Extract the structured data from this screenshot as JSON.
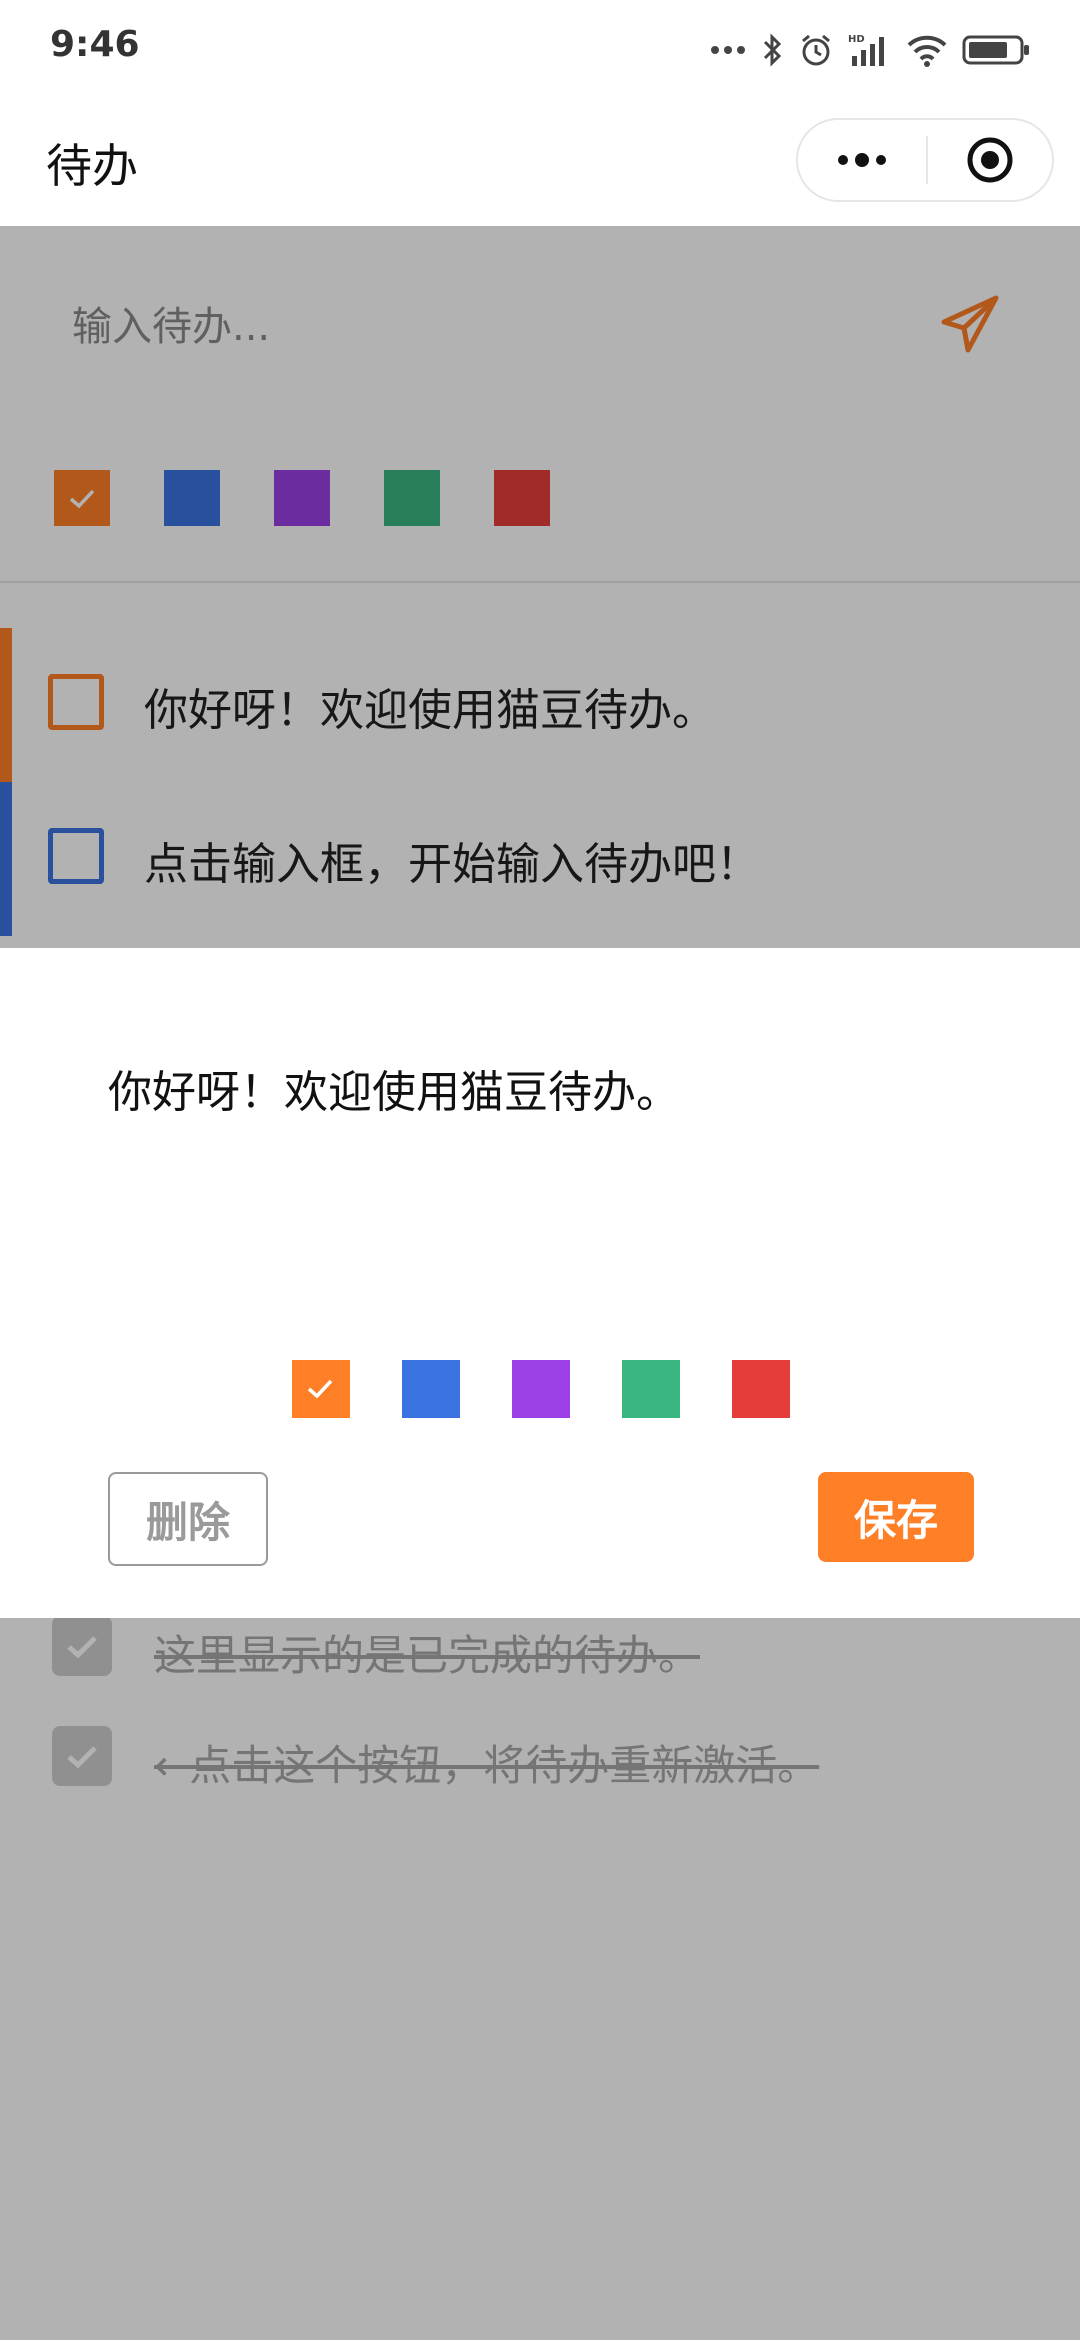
{
  "status_bar": {
    "time": "9:46",
    "icons": [
      "more-dots-icon",
      "bluetooth-icon",
      "alarm-icon",
      "hd-signal-icon",
      "wifi-icon",
      "battery-icon"
    ]
  },
  "nav": {
    "title": "待办",
    "more_icon": "more-dots-icon",
    "close_icon": "target-close-icon"
  },
  "input": {
    "placeholder": "输入待办...",
    "send_icon": "paper-plane-icon"
  },
  "color_options": [
    {
      "color": "#ff7f27",
      "selected": true
    },
    {
      "color": "#3a73e1",
      "selected": false
    },
    {
      "color": "#9a40e6",
      "selected": false
    },
    {
      "color": "#3ab780",
      "selected": false
    },
    {
      "color": "#e53e3a",
      "selected": false
    }
  ],
  "todos": [
    {
      "text": "你好呀！欢迎使用猫豆待办。",
      "color": "#ff7f27"
    },
    {
      "text": "点击输入框，开始输入待办吧！",
      "color": "#3a73e1"
    }
  ],
  "completed": [
    {
      "text": "这里显示的是已完成的待办。"
    },
    {
      "text": "←点击这个按钮，将待办重新激活。"
    }
  ],
  "edit_sheet": {
    "text": "你好呀！欢迎使用猫豆待办。",
    "delete_label": "删除",
    "save_label": "保存"
  }
}
